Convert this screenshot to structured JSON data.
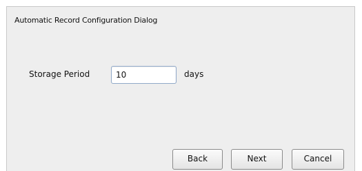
{
  "dialog": {
    "title": "Automatic Record Configuration Dialog",
    "storage_period": {
      "label": "Storage Period",
      "value": "10",
      "unit": "days"
    },
    "buttons": {
      "back": "Back",
      "next": "Next",
      "cancel": "Cancel"
    }
  }
}
